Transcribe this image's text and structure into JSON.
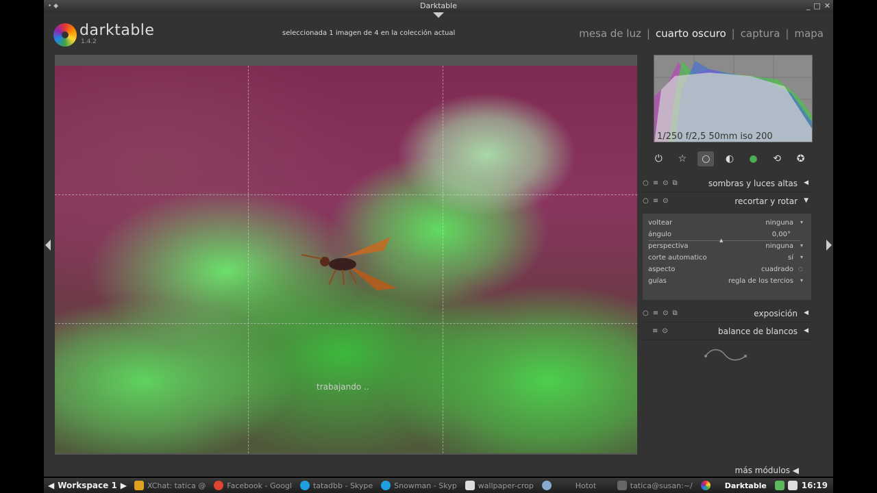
{
  "window": {
    "title": "Darktable",
    "buttons": [
      "_",
      "□",
      "✕"
    ]
  },
  "header": {
    "app_name": "darktable",
    "version": "1.4.2",
    "status": "seleccionada 1 imagen de 4 en la colección actual",
    "views": [
      {
        "label": "mesa de luz"
      },
      {
        "label": "cuarto oscuro"
      },
      {
        "label": "captura"
      },
      {
        "label": "mapa"
      }
    ],
    "separator": "|",
    "active_view": "cuarto oscuro"
  },
  "image": {
    "overlay_text": "trabajando .."
  },
  "histogram": {
    "exif": "1/250 f/2,5 50mm iso 200"
  },
  "module_groups": [
    {
      "icon": "power-icon",
      "glyph": "⏻"
    },
    {
      "icon": "star-icon",
      "glyph": "☆"
    },
    {
      "icon": "circle-icon",
      "glyph": "○"
    },
    {
      "icon": "tone-icon",
      "glyph": "◐"
    },
    {
      "icon": "color-icon",
      "glyph": "●"
    },
    {
      "icon": "correct-icon",
      "glyph": "⟲"
    },
    {
      "icon": "effect-icon",
      "glyph": "✪"
    }
  ],
  "modules": {
    "shadows": {
      "name": "sombras y luces altas"
    },
    "crop": {
      "name": "recortar y rotar",
      "params": {
        "flip": {
          "label": "voltear",
          "value": "ninguna"
        },
        "angle": {
          "label": "ángulo",
          "value": "0,00°"
        },
        "perspective": {
          "label": "perspectiva",
          "value": "ninguna"
        },
        "autocrop": {
          "label": "corte automatico",
          "value": "sí"
        },
        "aspect": {
          "label": "aspecto",
          "value": "cuadrado"
        },
        "guides": {
          "label": "guías",
          "value": "regla de los tercios"
        }
      }
    },
    "exposure": {
      "name": "exposición"
    },
    "white_balance": {
      "name": "balance de blancos"
    }
  },
  "more_modules": "más módulos",
  "taskbar": {
    "workspace": "Workspace 1",
    "items": [
      {
        "label": "XChat: tatica @",
        "color": "#e0a020"
      },
      {
        "label": "Facebook - Googl",
        "color": "#dd4433"
      },
      {
        "label": "tatadbb - Skype",
        "color": "#1ea0e0"
      },
      {
        "label": "Snowman - Skyp",
        "color": "#1ea0e0"
      },
      {
        "label": "wallpaper-crop",
        "color": "#dddddd"
      },
      {
        "label": "Hotot",
        "color": "#88aacc"
      },
      {
        "label": "tatica@susan:~/",
        "color": "#666666"
      },
      {
        "label": "Darktable",
        "color": "#e54b4b"
      }
    ],
    "clock": "16:19"
  }
}
